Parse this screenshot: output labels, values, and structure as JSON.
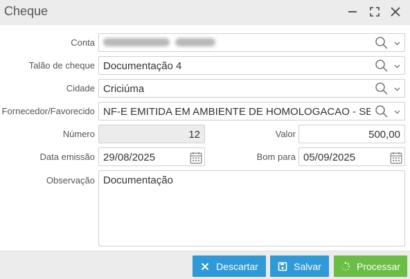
{
  "window": {
    "title": "Cheque"
  },
  "form": {
    "conta": {
      "label": "Conta"
    },
    "talao": {
      "label": "Talão de cheque",
      "value": "Documentação 4"
    },
    "cidade": {
      "label": "Cidade",
      "value": "Criciúma"
    },
    "fornecedor": {
      "label": "Fornecedor/Favorecido",
      "value": "NF-E EMITIDA EM AMBIENTE DE HOMOLOGACAO - SEM VA"
    },
    "numero": {
      "label": "Número",
      "value": "12"
    },
    "valor": {
      "label": "Valor",
      "value": "500,00"
    },
    "data_emissao": {
      "label": "Data emissão",
      "value": "29/08/2025"
    },
    "bom_para": {
      "label": "Bom para",
      "value": "05/09/2025"
    },
    "observacao": {
      "label": "Observação",
      "value": "Documentação"
    }
  },
  "buttons": {
    "descartar": "Descartar",
    "salvar": "Salvar",
    "processar": "Processar"
  },
  "colors": {
    "primary_button": "#2f9ad7",
    "success_button": "#6abe45",
    "title_bar": "#ececec"
  },
  "icons": {
    "minimize": "minimize-icon",
    "maximize": "maximize-icon",
    "close": "close-icon",
    "search": "search-icon",
    "dropdown": "chevron-down-icon",
    "calendar": "calendar-icon",
    "discard": "x-icon",
    "save": "floppy-icon",
    "process": "spinner-icon"
  }
}
